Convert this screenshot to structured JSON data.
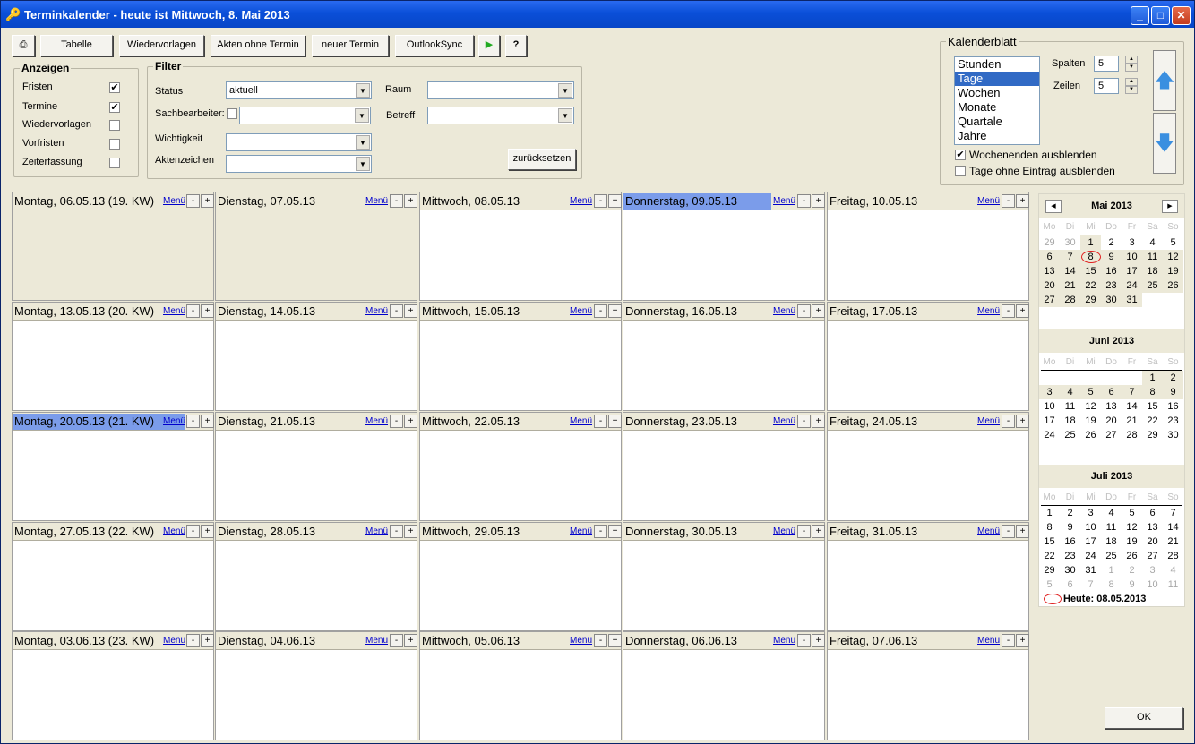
{
  "window": {
    "title": "Terminkalender - heute ist Mittwoch, 8. Mai 2013"
  },
  "toolbar": {
    "buttons": [
      "Tabelle",
      "Wiedervorlagen",
      "Akten ohne Termin",
      "neuer Termin",
      "OutlookSync"
    ],
    "help_label": "?",
    "print_icon": "printer-icon",
    "exec_icon": "run-icon"
  },
  "anzeigen": {
    "legend": "Anzeigen",
    "items": [
      {
        "label": "Fristen",
        "checked": true
      },
      {
        "label": "Termine",
        "checked": true
      },
      {
        "label": "Wiedervorlagen",
        "checked": false
      },
      {
        "label": "Vorfristen",
        "checked": false
      },
      {
        "label": "Zeiterfassung",
        "checked": false
      }
    ]
  },
  "filter": {
    "legend": "Filter",
    "status_label": "Status",
    "status_value": "aktuell",
    "sachbearbeiter_label": "Sachbearbeiter:",
    "wichtigkeit_label": "Wichtigkeit",
    "aktenzeichen_label": "Aktenzeichen",
    "raum_label": "Raum",
    "betreff_label": "Betreff",
    "reset_label": "zurücksetzen"
  },
  "kalenderblatt": {
    "legend": "Kalenderblatt",
    "views": [
      "Stunden",
      "Tage",
      "Wochen",
      "Monate",
      "Quartale",
      "Jahre"
    ],
    "selected_view": "Tage",
    "spalten_label": "Spalten",
    "spalten_value": "5",
    "zeilen_label": "Zeilen",
    "zeilen_value": "5",
    "hide_weekends_label": "Wochenenden ausblenden",
    "hide_weekends": true,
    "hide_empty_label": "Tage ohne Eintrag ausblenden",
    "hide_empty": false
  },
  "grid": {
    "menu_label": "Menü",
    "minus_label": "-",
    "plus_label": "+",
    "rows": [
      [
        "Montag, 06.05.13 (19. KW)",
        "Dienstag, 07.05.13",
        "Mittwoch, 08.05.13",
        "Donnerstag, 09.05.13",
        "Freitag, 10.05.13"
      ],
      [
        "Montag, 13.05.13 (20. KW)",
        "Dienstag, 14.05.13",
        "Mittwoch, 15.05.13",
        "Donnerstag, 16.05.13",
        "Freitag, 17.05.13"
      ],
      [
        "Montag, 20.05.13 (21. KW)",
        "Dienstag, 21.05.13",
        "Mittwoch, 22.05.13",
        "Donnerstag, 23.05.13",
        "Freitag, 24.05.13"
      ],
      [
        "Montag, 27.05.13 (22. KW)",
        "Dienstag, 28.05.13",
        "Mittwoch, 29.05.13",
        "Donnerstag, 30.05.13",
        "Freitag, 31.05.13"
      ],
      [
        "Montag, 03.06.13 (23. KW)",
        "Dienstag, 04.06.13",
        "Mittwoch, 05.06.13",
        "Donnerstag, 06.06.13",
        "Freitag, 07.06.13"
      ]
    ],
    "highlighted": [
      "Donnerstag, 09.05.13",
      "Montag, 20.05.13 (21. KW)"
    ],
    "past_cells": [
      "Montag, 06.05.13 (19. KW)",
      "Dienstag, 07.05.13"
    ]
  },
  "minicalendar": {
    "prev_icon": "arrow-left-icon",
    "next_icon": "arrow-right-icon",
    "weekdays": [
      "Mo",
      "Di",
      "Mi",
      "Do",
      "Fr",
      "Sa",
      "So"
    ],
    "months": [
      {
        "title": "Mai 2013",
        "weeks": [
          [
            "29",
            "30",
            "1",
            "2",
            "3",
            "4",
            "5"
          ],
          [
            "6",
            "7",
            "8",
            "9",
            "10",
            "11",
            "12"
          ],
          [
            "13",
            "14",
            "15",
            "16",
            "17",
            "18",
            "19"
          ],
          [
            "20",
            "21",
            "22",
            "23",
            "24",
            "25",
            "26"
          ],
          [
            "27",
            "28",
            "29",
            "30",
            "31",
            "",
            ""
          ]
        ],
        "other": [
          [
            0,
            0
          ],
          [
            0,
            1
          ]
        ],
        "shaded_rows": [
          1,
          2,
          3,
          4
        ],
        "shaded_cells": [
          [
            0,
            2
          ]
        ]
      },
      {
        "title": "Juni 2013",
        "weeks": [
          [
            "",
            "",
            "",
            "",
            "",
            "1",
            "2"
          ],
          [
            "3",
            "4",
            "5",
            "6",
            "7",
            "8",
            "9"
          ],
          [
            "10",
            "11",
            "12",
            "13",
            "14",
            "15",
            "16"
          ],
          [
            "17",
            "18",
            "19",
            "20",
            "21",
            "22",
            "23"
          ],
          [
            "24",
            "25",
            "26",
            "27",
            "28",
            "29",
            "30"
          ]
        ],
        "other": [],
        "shaded_rows": [
          0,
          1
        ],
        "shaded_cells": []
      },
      {
        "title": "Juli 2013",
        "weeks": [
          [
            "1",
            "2",
            "3",
            "4",
            "5",
            "6",
            "7"
          ],
          [
            "8",
            "9",
            "10",
            "11",
            "12",
            "13",
            "14"
          ],
          [
            "15",
            "16",
            "17",
            "18",
            "19",
            "20",
            "21"
          ],
          [
            "22",
            "23",
            "24",
            "25",
            "26",
            "27",
            "28"
          ],
          [
            "29",
            "30",
            "31",
            "1",
            "2",
            "3",
            "4"
          ],
          [
            "5",
            "6",
            "7",
            "8",
            "9",
            "10",
            "11"
          ]
        ],
        "other": [
          [
            4,
            3
          ],
          [
            4,
            4
          ],
          [
            4,
            5
          ],
          [
            4,
            6
          ],
          [
            5,
            0
          ],
          [
            5,
            1
          ],
          [
            5,
            2
          ],
          [
            5,
            3
          ],
          [
            5,
            4
          ],
          [
            5,
            5
          ],
          [
            5,
            6
          ]
        ],
        "shaded_rows": [],
        "shaded_cells": []
      }
    ],
    "today_label": "Heute: 08.05.2013"
  },
  "ok_label": "OK"
}
